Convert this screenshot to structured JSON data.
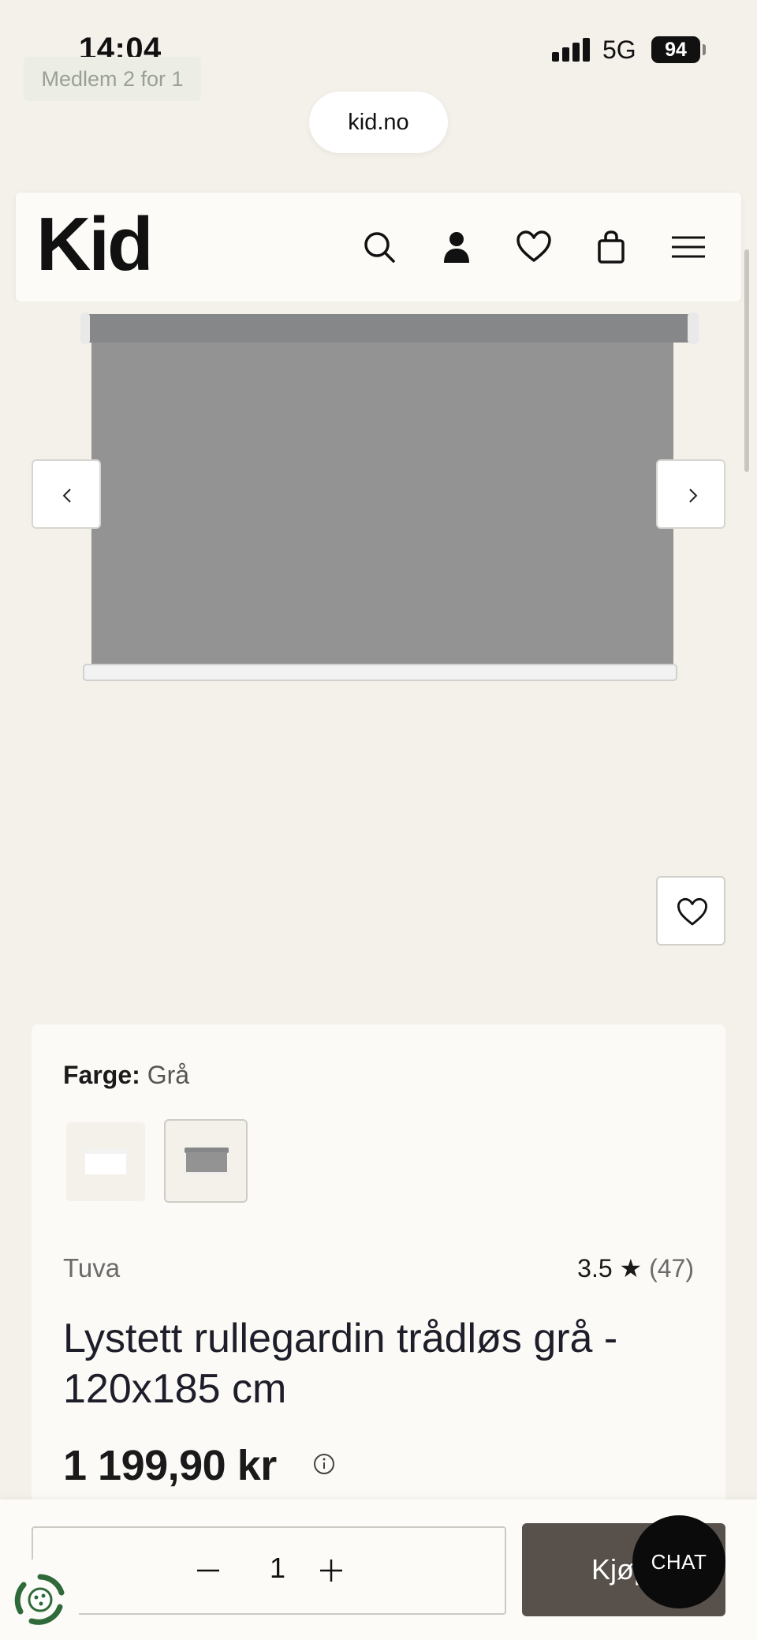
{
  "status": {
    "time": "14:04",
    "network": "5G",
    "battery": "94"
  },
  "promo": {
    "label": "Medlem 2 for 1"
  },
  "browser": {
    "url": "kid.no"
  },
  "header": {
    "logo": "Kid",
    "icons": [
      "search-icon",
      "user-icon",
      "heart-icon",
      "bag-icon",
      "menu-icon"
    ]
  },
  "product": {
    "color_label": "Farge:",
    "color_value": "Grå",
    "swatches": [
      "white",
      "grey"
    ],
    "selected_swatch": "grey",
    "brand": "Tuva",
    "rating": "3.5",
    "star": "★",
    "reviews": "(47)",
    "title": "Lystett rullegardin trådløs grå - 120x185 cm",
    "price": "1 199,90 kr"
  },
  "cart": {
    "quantity": "1",
    "buy_label": "Kjøp"
  },
  "chat": {
    "label": "CHAT"
  },
  "colors": {
    "buy_button": "#58504a",
    "background": "#f4f0ea",
    "blind_grey": "#939393"
  }
}
